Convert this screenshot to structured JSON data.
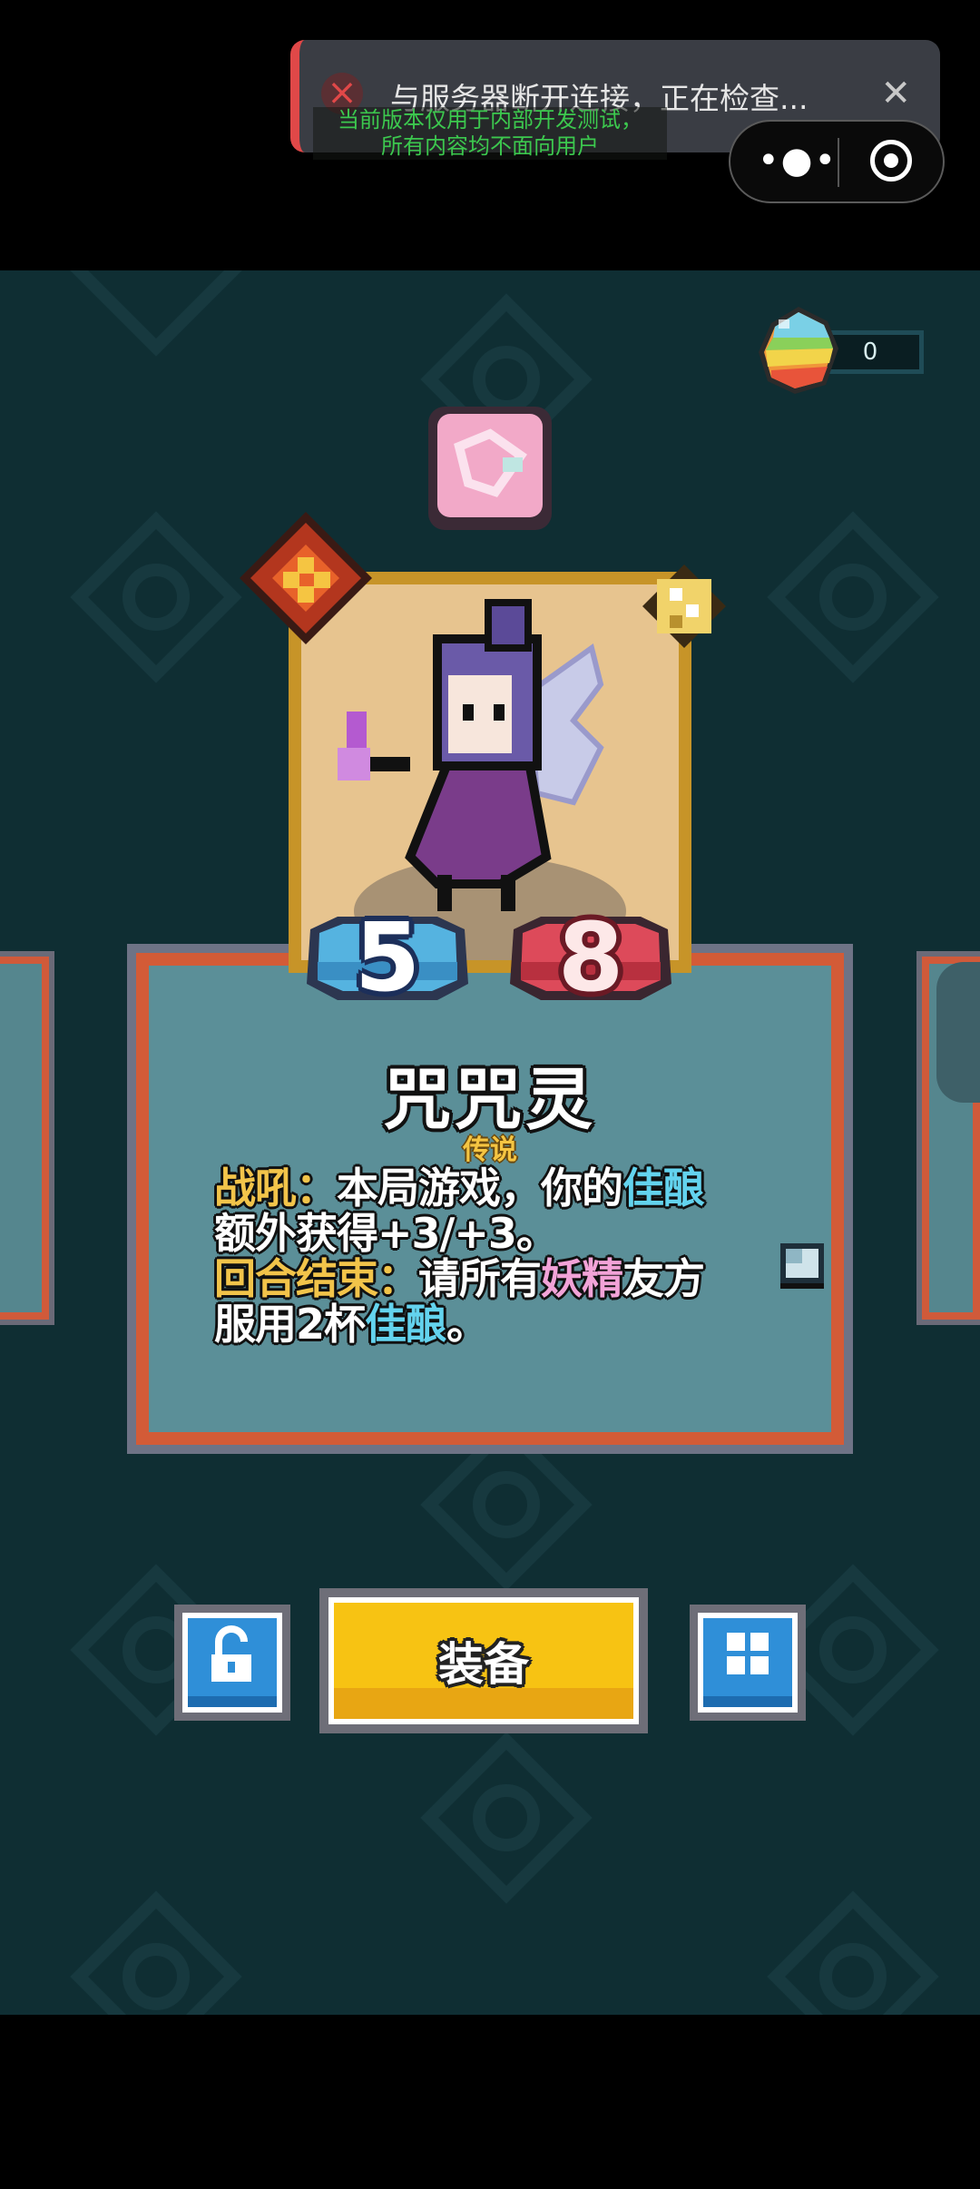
{
  "notification": {
    "message": "与服务器断开连接，正在检查...",
    "close_icon": "close-icon",
    "error_icon": "error-x-icon",
    "accent_color": "#e04848"
  },
  "dev_notice": {
    "line1": "当前版本仅用于内部开发测试，",
    "line2": "所有内容均不面向用户"
  },
  "capsule": {
    "more_icon": "more-dots-icon",
    "target_icon": "target-icon"
  },
  "currency": {
    "amount": "0",
    "icon": "rainbow-gem-icon"
  },
  "card": {
    "name": "咒咒灵",
    "rarity": "传说",
    "attack": "5",
    "health": "8",
    "description": {
      "line1": {
        "kw1": "战吼：",
        "text1": "本局游戏，你的",
        "kw2": "佳酿"
      },
      "line2": {
        "text1": "额外获得+3/+3。"
      },
      "line3": {
        "kw1": "回合结束：",
        "text1": "请所有",
        "kw2": "妖精",
        "text2": "友方"
      },
      "line4": {
        "text1": "服用2杯",
        "kw1": "佳酿",
        "text2": "。"
      }
    },
    "colors": {
      "frame": "#d35b37",
      "inner": "#5b8f98",
      "keyword_gold": "#f2c44a",
      "keyword_cyan": "#63d3ee",
      "keyword_pink": "#f2a3d8"
    }
  },
  "buttons": {
    "equip_label": "装备",
    "lock_icon": "unlock-icon",
    "grid_icon": "grid-icon",
    "equip_color": "#f7c313"
  }
}
